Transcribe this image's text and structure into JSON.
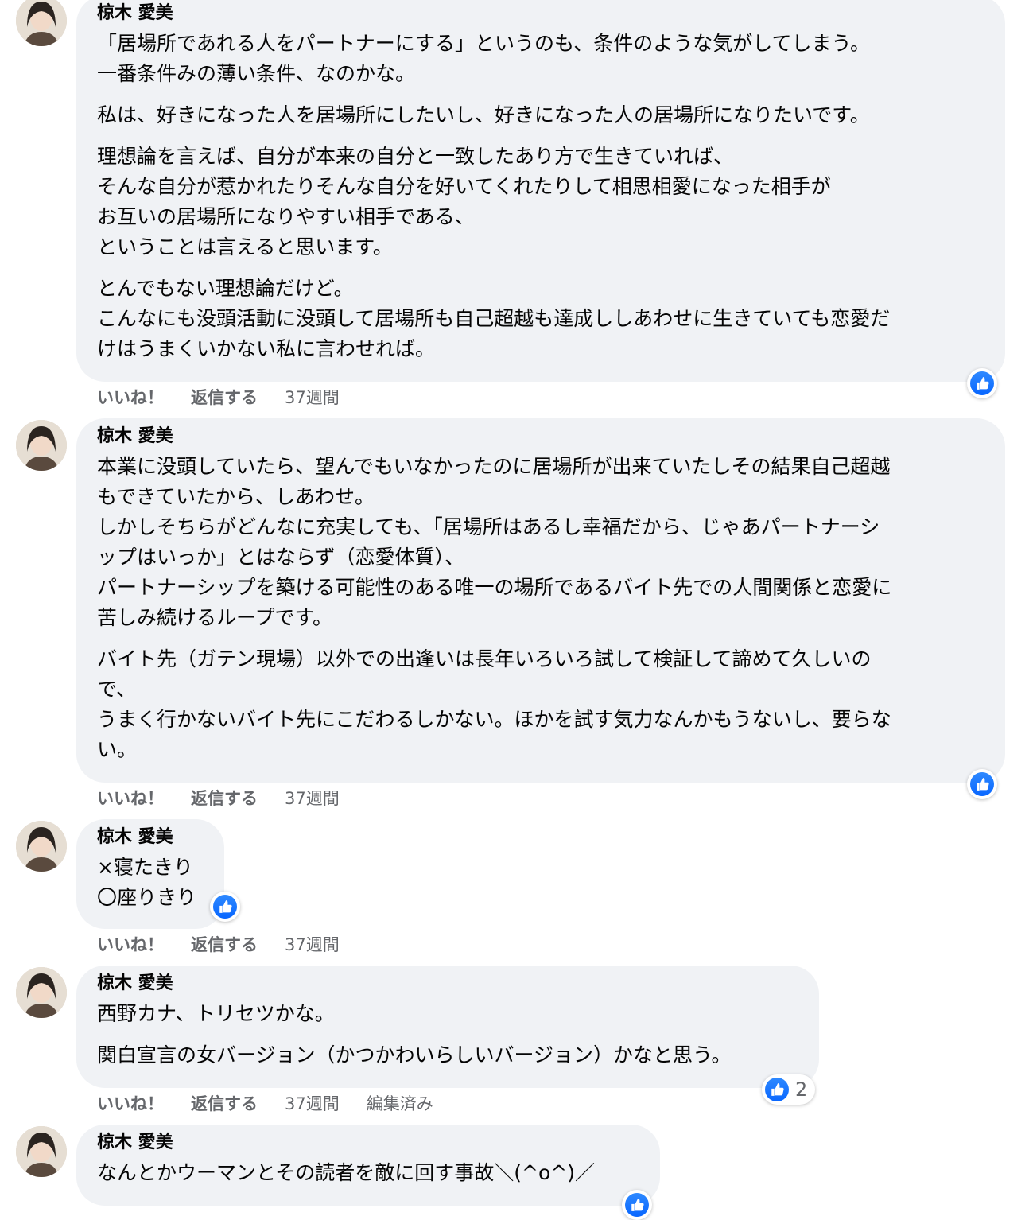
{
  "comments": [
    {
      "author": "椋木 愛美",
      "paragraphs": [
        [
          "「居場所であれる人をパートナーにする」というのも、条件のような気がしてしまう。",
          "一番条件みの薄い条件、なのかな。"
        ],
        [
          "私は、好きになった人を居場所にしたいし、好きになった人の居場所になりたいです。"
        ],
        [
          "理想論を言えば、自分が本来の自分と一致したあり方で生きていれば、",
          "そんな自分が惹かれたりそんな自分を好いてくれたりして相思相愛になった相手が",
          "お互いの居場所になりやすい相手である、",
          "ということは言えると思います。"
        ],
        [
          "とんでもない理想論だけど。",
          "こんなにも没頭活動に没頭して居場所も自己超越も達成ししあわせに生きていても恋愛だ",
          "けはうまくいかない私に言わせれば。"
        ]
      ],
      "like_label": "いいね！",
      "reply_label": "返信する",
      "time": "37週間",
      "reaction_count": ""
    },
    {
      "author": "椋木 愛美",
      "paragraphs": [
        [
          "本業に没頭していたら、望んでもいなかったのに居場所が出来ていたしその結果自己超越",
          "もできていたから、しあわせ。",
          "しかしそちらがどんなに充実しても、「居場所はあるし幸福だから、じゃあパートナーシ",
          "ップはいっか」とはならず（恋愛体質）、",
          "パートナーシップを築ける可能性のある唯一の場所であるバイト先での人間関係と恋愛に",
          "苦しみ続けるループです。"
        ],
        [
          "バイト先（ガテン現場）以外での出逢いは長年いろいろ試して検証して諦めて久しいの",
          "で、",
          "うまく行かないバイト先にこだわるしかない。ほかを試す気力なんかもうないし、要らな",
          "い。"
        ]
      ],
      "like_label": "いいね！",
      "reply_label": "返信する",
      "time": "37週間",
      "reaction_count": ""
    },
    {
      "author": "椋木 愛美",
      "paragraphs": [
        [
          "×寝たきり",
          "〇座りきり"
        ]
      ],
      "like_label": "いいね！",
      "reply_label": "返信する",
      "time": "37週間",
      "reaction_count": ""
    },
    {
      "author": "椋木 愛美",
      "paragraphs": [
        [
          "西野カナ、トリセツかな。"
        ],
        [
          "関白宣言の女バージョン（かつかわいらしいバージョン）かなと思う。"
        ]
      ],
      "like_label": "いいね！",
      "reply_label": "返信する",
      "time": "37週間",
      "edited": "編集済み",
      "reaction_count": "2"
    },
    {
      "author": "椋木 愛美",
      "paragraphs": [
        [
          "なんとかウーマンとその読者を敵に回す事故＼(^o^)／"
        ]
      ],
      "reaction_count": ""
    }
  ]
}
